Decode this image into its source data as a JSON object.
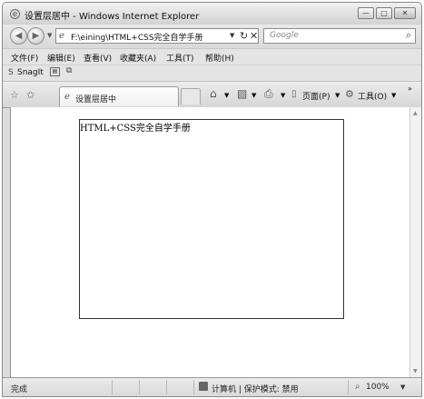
{
  "window": {
    "title": "设置层居中 - Windows Internet Explorer",
    "minimize": "—",
    "maximize": "□",
    "close": "✕"
  },
  "addressbar": {
    "url": "F:\\eining\\HTML+CSS完全自学手册",
    "search_placeholder": "Google"
  },
  "menubar": {
    "items": [
      "文件(F)",
      "编辑(E)",
      "查看(V)",
      "收藏夹(A)",
      "工具(T)",
      "帮助(H)"
    ]
  },
  "snagit": {
    "label": "SnagIt"
  },
  "tabbar": {
    "tab_title": "设置层居中",
    "page_menu": "页面(P)",
    "tools_menu": "工具(O)"
  },
  "content": {
    "layer_text": "HTML+CSS完全自学手册"
  },
  "statusbar": {
    "status": "完成",
    "zone": "计算机 | 保护模式: 禁用",
    "zoom": "100%"
  }
}
